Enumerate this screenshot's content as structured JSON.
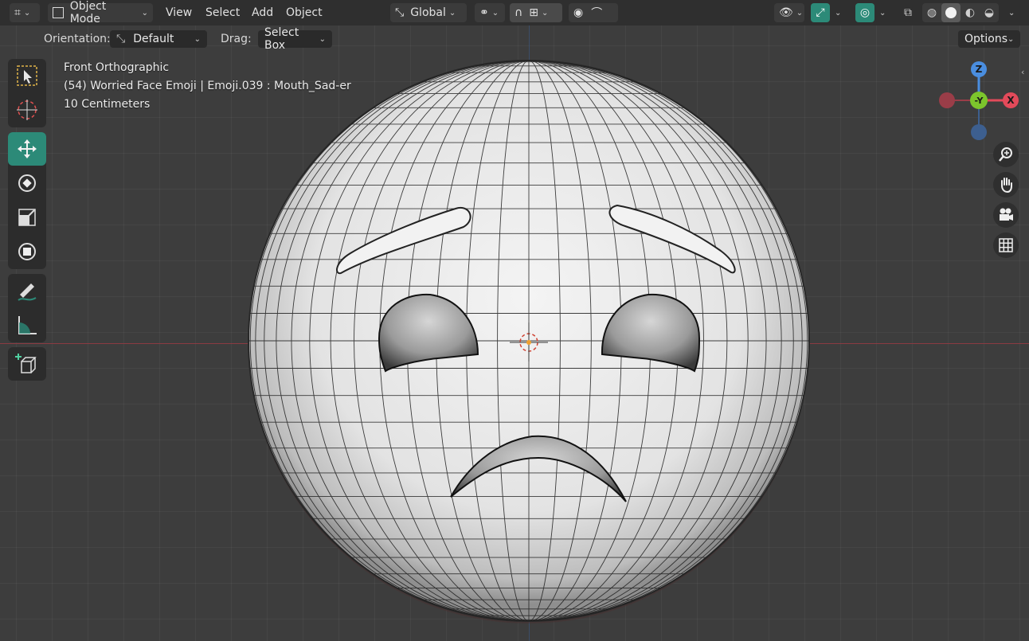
{
  "header": {
    "editor_type_icon": "axis-editor-icon",
    "mode": {
      "label": "Object Mode"
    },
    "menus": [
      "View",
      "Select",
      "Add",
      "Object"
    ],
    "transform_orientation": {
      "label": "Global"
    },
    "icons": {
      "pivot": "pivot-icon",
      "snap": "magnet-icon",
      "snap_increment": "increment-icon",
      "proportional": "proportional-icon",
      "falloff": "falloff-icon",
      "visibility": "eye-icon",
      "gizmo": "gizmo-icon",
      "overlay": "overlay-icon",
      "xray": "xray-icon",
      "shading": [
        "wireframe-icon",
        "solid-icon",
        "material-icon",
        "rendered-icon"
      ]
    },
    "accent_color": "#2c8a78"
  },
  "tool_header": {
    "orientation_label": "Orientation:",
    "orientation_value": "Default",
    "drag_label": "Drag:",
    "drag_value": "Select Box",
    "options_label": "Options"
  },
  "toolbar": {
    "tools": [
      "select-box-icon",
      "cursor-icon",
      "move-icon",
      "rotate-icon",
      "scale-icon",
      "transform-icon",
      "annotate-icon",
      "measure-icon",
      "add-cube-icon"
    ],
    "active_tool": "move-icon"
  },
  "viewport": {
    "view_name": "Front Orthographic",
    "object_info": "(54) Worried Face Emoji | Emoji.039 : Mouth_Sad-er",
    "scale_info": "10 Centimeters"
  },
  "gizmo": {
    "axes": {
      "z": "Z",
      "y": "-Y",
      "x": "X"
    },
    "colors": {
      "x": "#e34a5a",
      "y": "#7cc52c",
      "z": "#4a8ee0"
    }
  },
  "nav_buttons": [
    "zoom-icon",
    "hand-pan-icon",
    "camera-icon",
    "grid-icon"
  ]
}
